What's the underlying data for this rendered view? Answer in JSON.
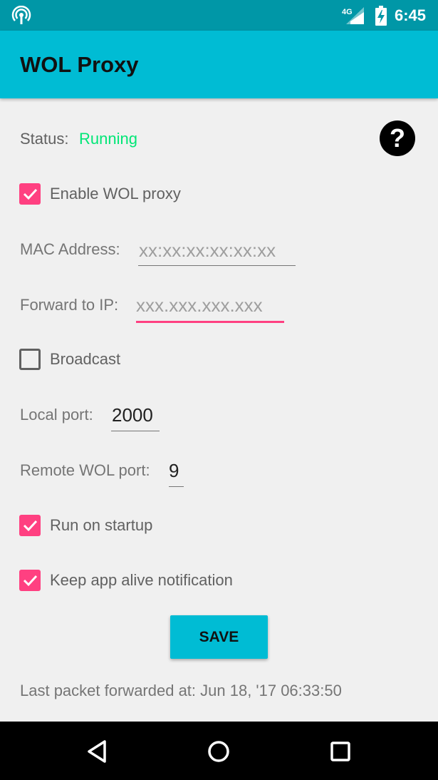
{
  "statusbar": {
    "network_label": "4G",
    "time": "6:45"
  },
  "appbar": {
    "title": "WOL Proxy"
  },
  "status": {
    "label": "Status:",
    "value": "Running",
    "value_color": "#00e676"
  },
  "help": {
    "glyph": "?"
  },
  "enable_proxy": {
    "label": "Enable WOL proxy",
    "checked": true
  },
  "mac": {
    "label": "MAC Address:",
    "placeholder": "xx:xx:xx:xx:xx:xx",
    "value": ""
  },
  "forward_ip": {
    "label": "Forward to IP:",
    "placeholder": "xxx.xxx.xxx.xxx",
    "value": ""
  },
  "broadcast": {
    "label": "Broadcast",
    "checked": false
  },
  "local_port": {
    "label": "Local port:",
    "value": "2000"
  },
  "remote_port": {
    "label": "Remote WOL port:",
    "value": "9"
  },
  "run_on_startup": {
    "label": "Run on startup",
    "checked": true
  },
  "keep_alive": {
    "label": "Keep app alive notification",
    "checked": true
  },
  "save_button": {
    "label": "SAVE"
  },
  "last_packet": {
    "text": "Last packet forwarded at: Jun 18, '17 06:33:50"
  },
  "colors": {
    "primary": "#00bcd4",
    "primary_dark": "#0097a7",
    "accent": "#ff4081"
  }
}
